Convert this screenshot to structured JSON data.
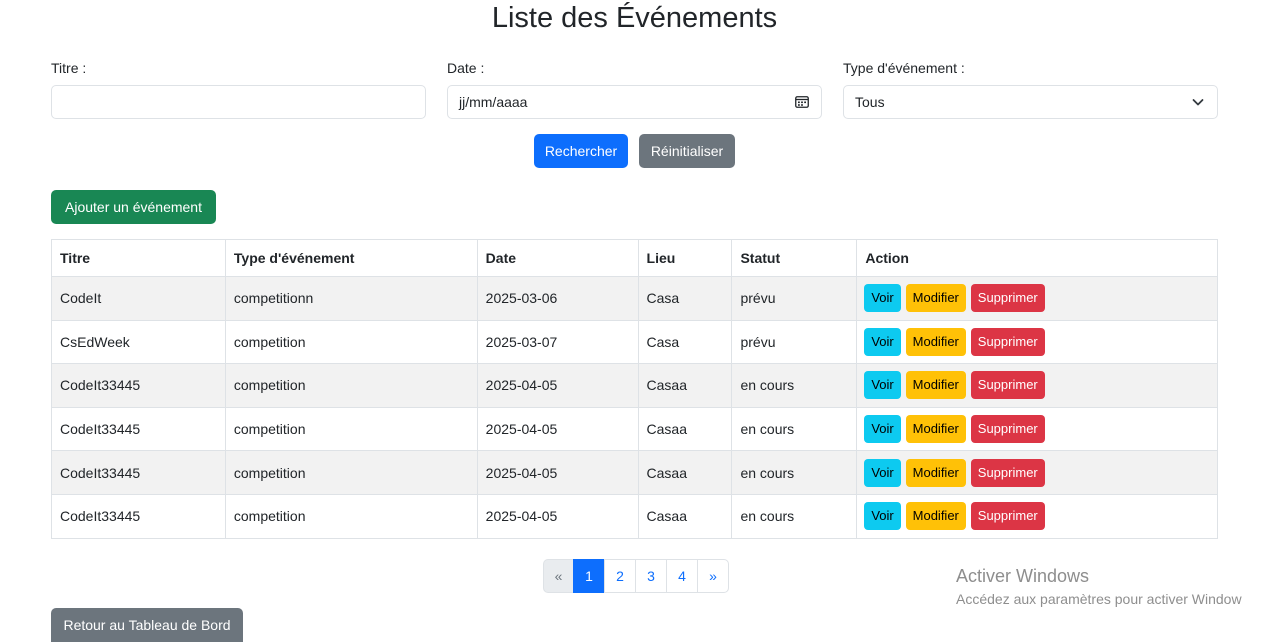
{
  "page_title": "Liste des Événements",
  "filters": {
    "title_label": "Titre :",
    "title_value": "",
    "date_label": "Date :",
    "date_placeholder": "jj/mm/aaaa",
    "type_label": "Type d'événement :",
    "type_selected": "Tous"
  },
  "buttons": {
    "search": "Rechercher",
    "reset": "Réinitialiser",
    "add": "Ajouter un événement",
    "back": "Retour au Tableau de Bord"
  },
  "table": {
    "headers": [
      "Titre",
      "Type d'événement",
      "Date",
      "Lieu",
      "Statut",
      "Action"
    ],
    "rows": [
      {
        "titre": "CodeIt",
        "type": "competitionn",
        "date": "2025-03-06",
        "lieu": "Casa",
        "statut": "prévu"
      },
      {
        "titre": "CsEdWeek",
        "type": "competition",
        "date": "2025-03-07",
        "lieu": "Casa",
        "statut": "prévu"
      },
      {
        "titre": "CodeIt33445",
        "type": "competition",
        "date": "2025-04-05",
        "lieu": "Casaa",
        "statut": "en cours"
      },
      {
        "titre": "CodeIt33445",
        "type": "competition",
        "date": "2025-04-05",
        "lieu": "Casaa",
        "statut": "en cours"
      },
      {
        "titre": "CodeIt33445",
        "type": "competition",
        "date": "2025-04-05",
        "lieu": "Casaa",
        "statut": "en cours"
      },
      {
        "titre": "CodeIt33445",
        "type": "competition",
        "date": "2025-04-05",
        "lieu": "Casaa",
        "statut": "en cours"
      }
    ],
    "action_labels": {
      "view": "Voir",
      "edit": "Modifier",
      "delete": "Supprimer"
    }
  },
  "pagination": {
    "prev": "«",
    "pages": [
      "1",
      "2",
      "3",
      "4"
    ],
    "active_page": "1",
    "next": "»"
  },
  "watermark": {
    "title": "Activer Windows",
    "subtitle": "Accédez aux paramètres pour activer Window"
  },
  "colors": {
    "primary": "#0d6efd",
    "secondary": "#6c757d",
    "success": "#198754",
    "info": "#0dcaf0",
    "warning": "#ffc107",
    "danger": "#dc3545"
  },
  "icons": {
    "date_field": "calendar-icon",
    "type_select": "chevron-down-icon"
  }
}
